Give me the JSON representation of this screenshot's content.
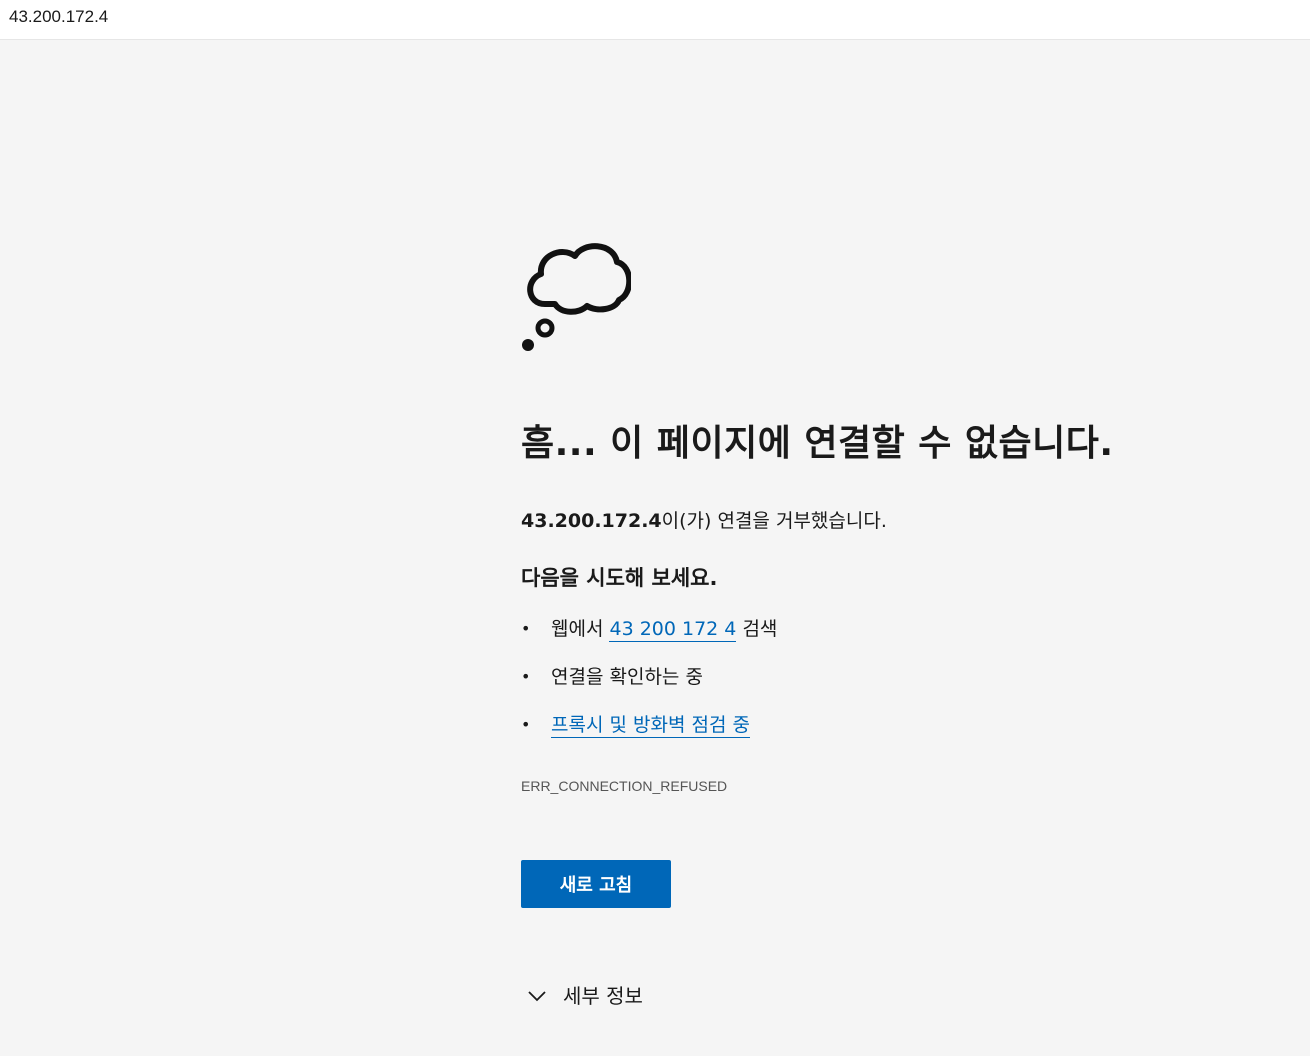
{
  "address_bar": {
    "url": "43.200.172.4"
  },
  "error_page": {
    "icon": "thought-cloud-icon",
    "headline": "흠... 이 페이지에 연결할 수 없습니다.",
    "refused_host": "43.200.172.4",
    "refused_message": "이(가) 연결을 거부했습니다.",
    "try_heading": "다음을 시도해 보세요.",
    "suggestions": [
      {
        "prefix": "웹에서 ",
        "link": "43 200 172 4",
        "suffix": " 검색"
      },
      {
        "text": "연결을 확인하는 중"
      },
      {
        "link": "프록시 및 방화벽 점검 중"
      }
    ],
    "error_code": "ERR_CONNECTION_REFUSED",
    "refresh_label": "새로 고침",
    "details_label": "세부 정보"
  },
  "colors": {
    "accent": "#0067b8",
    "background": "#f5f5f5",
    "text": "#1a1a1a"
  }
}
